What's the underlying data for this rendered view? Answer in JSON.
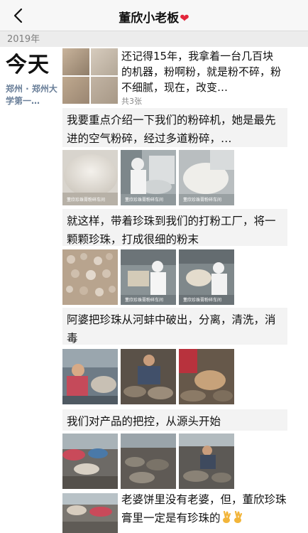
{
  "header": {
    "title": "董欣小老板",
    "title_emoji": "heart-emoji",
    "back_icon": "chevron-left-icon"
  },
  "year": "2019年",
  "entry": {
    "date": "今天",
    "location": "郑州 · 郑州大学第一…"
  },
  "cover_post": {
    "text": "还记得15年，我拿着一台几百块的机器，粉啊粉，就是粉不碎，粉不细腻，现在，改变…",
    "count": "共3张"
  },
  "posts": [
    {
      "text": "我要重点介绍一下我们的粉碎机，她是最先进的空气粉碎，经过多道粉碎，…"
    },
    {
      "text": "就这样，带着珍珠到我们的打粉工厂，将一颗颗珍珠，打成很细的粉末"
    },
    {
      "text": "阿婆把珍珠从河蚌中破出，分离，清洗，消毒"
    },
    {
      "text": "我们对产品的把控，从源头开始"
    },
    {
      "text": "老婆饼里没有老婆，但，董欣珍珠膏里一定是有珍珠的"
    }
  ],
  "photo_watermarks": [
    "董欣珍珠膏粉碎车间",
    "董欣珍珠膏粉碎车间",
    "董欣珍珠膏粉碎车间",
    "董欣珍珠膏粉碎车间",
    "董欣珍珠膏粉碎车间"
  ],
  "colors": {
    "nav_bg": "#f7f7f7",
    "text_box_bg": "#f3f3f3",
    "location_text": "#6a7f99",
    "heart": "#e3263b"
  }
}
